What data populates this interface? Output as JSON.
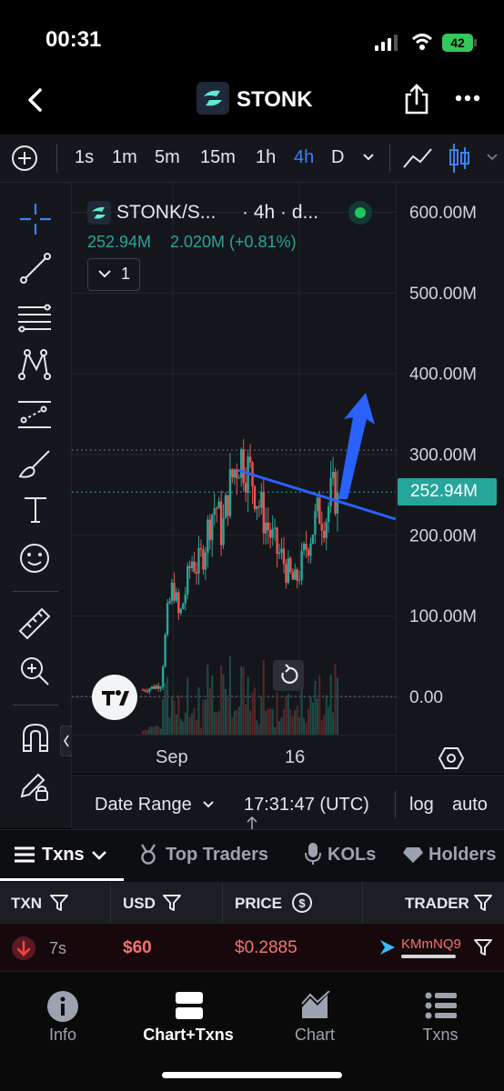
{
  "status_bar": {
    "time": "00:31",
    "battery": "42"
  },
  "header": {
    "title": "STONK",
    "back_icon": "chevron-left-icon",
    "share_icon": "share-icon",
    "more_icon": "more-horizontal-icon"
  },
  "intervals": {
    "items": [
      "1s",
      "1m",
      "5m",
      "15m",
      "1h",
      "4h",
      "D"
    ],
    "active": "4h"
  },
  "chart": {
    "symbol": "STONK/S...",
    "interval_info": "· 4h · d...",
    "price_line": "252.94M",
    "change_line": "2.020M (+0.81%)",
    "indicators_count": "1",
    "current_price_tag": "252.94M",
    "colors": {
      "up": "#26a69a",
      "down": "#ef5350",
      "drawing": "#2962ff",
      "background": "#14161b"
    }
  },
  "chart_data": {
    "type": "candlestick",
    "y_axis_labels": [
      "600.00M",
      "500.00M",
      "400.00M",
      "300.00M",
      "200.00M",
      "100.00M",
      "0.00"
    ],
    "ylim": [
      0,
      600000000
    ],
    "x_axis_labels": [
      "Sep",
      "16"
    ],
    "current_value": 252940000,
    "description_series": [
      {
        "name": "",
        "values_m": [
          8,
          10,
          12,
          15,
          100,
          140,
          95,
          130,
          170,
          160,
          180,
          220,
          240,
          200,
          250,
          280,
          300,
          285,
          270,
          240,
          220,
          200,
          180,
          170,
          150,
          140,
          160,
          190,
          210,
          230,
          220,
          250,
          252.94
        ]
      }
    ]
  },
  "date_bar": {
    "date_range": "Date Range",
    "time": "17:31:47 (UTC)",
    "log": "log",
    "auto": "auto"
  },
  "tabs": {
    "items": [
      "Txns",
      "Top Traders",
      "KOLs",
      "Holders"
    ],
    "active": "Txns"
  },
  "table": {
    "headers": [
      "TXN",
      "USD",
      "PRICE",
      "TRADER"
    ],
    "rows": [
      {
        "age": "7s",
        "usd": "$60",
        "price": "$0.2885",
        "trader": "KMmNQ9"
      }
    ]
  },
  "bottom_nav": {
    "items": [
      "Info",
      "Chart+Txns",
      "Chart",
      "Txns"
    ],
    "active": "Chart+Txns"
  }
}
